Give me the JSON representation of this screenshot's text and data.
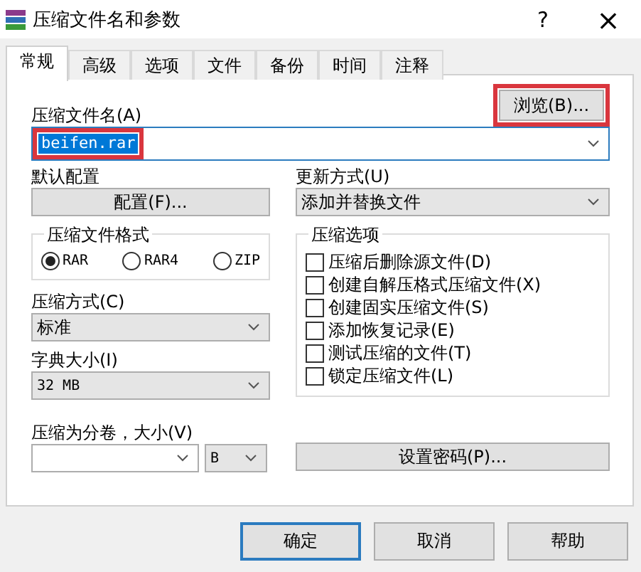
{
  "window": {
    "title": "压缩文件名和参数",
    "help": "?",
    "close": "×"
  },
  "tabs": [
    {
      "label": "常规",
      "selected": true
    },
    {
      "label": "高级",
      "selected": false
    },
    {
      "label": "选项",
      "selected": false
    },
    {
      "label": "文件",
      "selected": false
    },
    {
      "label": "备份",
      "selected": false
    },
    {
      "label": "时间",
      "selected": false
    },
    {
      "label": "注释",
      "selected": false
    }
  ],
  "archive_name": {
    "label": "压缩文件名(A)",
    "value": "beifen.rar",
    "highlighted": true
  },
  "browse_button": {
    "label": "浏览(B)...",
    "highlighted": true
  },
  "profiles": {
    "label": "默认配置",
    "button": "配置(F)..."
  },
  "update_mode": {
    "label": "更新方式(U)",
    "value": "添加并替换文件"
  },
  "archive_format": {
    "label": "压缩文件格式",
    "options": [
      {
        "label": "RAR",
        "selected": true
      },
      {
        "label": "RAR4",
        "selected": false
      },
      {
        "label": "ZIP",
        "selected": false
      }
    ]
  },
  "archiving_options": {
    "label": "压缩选项",
    "items": [
      {
        "label": "压缩后删除源文件(D)",
        "checked": false
      },
      {
        "label": "创建自解压格式压缩文件(X)",
        "checked": false
      },
      {
        "label": "创建固实压缩文件(S)",
        "checked": false
      },
      {
        "label": "添加恢复记录(E)",
        "checked": false
      },
      {
        "label": "测试压缩的文件(T)",
        "checked": false
      },
      {
        "label": "锁定压缩文件(L)",
        "checked": false
      }
    ]
  },
  "compression_method": {
    "label": "压缩方式(C)",
    "value": "标准"
  },
  "dictionary_size": {
    "label": "字典大小(I)",
    "value": "32 MB"
  },
  "split_volumes": {
    "label": "压缩为分卷，大小(V)",
    "unit": "B"
  },
  "password_button": "设置密码(P)...",
  "buttons": [
    {
      "label": "确定",
      "default": true
    },
    {
      "label": "取消",
      "default": false
    },
    {
      "label": "帮助",
      "default": false
    }
  ]
}
